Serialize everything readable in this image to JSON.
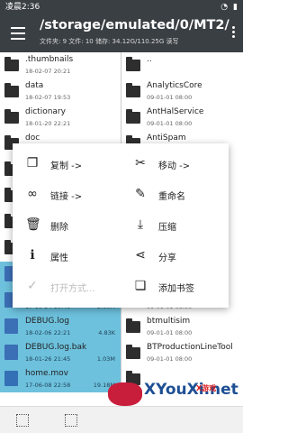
{
  "status": {
    "time": "凌晨2:36"
  },
  "appbar": {
    "path": "/storage/emulated/0/MT2/",
    "info": "文件夹: 9  文件: 10  储存: 34.12G/110.25G  读写"
  },
  "left_pane": [
    {
      "name": ".thumbnails",
      "meta": "18-02-07 20:21",
      "size": "",
      "type": "folder",
      "selected": false
    },
    {
      "name": "data",
      "meta": "18-02-07 19:53",
      "size": "",
      "type": "folder",
      "selected": false
    },
    {
      "name": "dictionary",
      "meta": "18-01-20 22:21",
      "size": "",
      "type": "folder",
      "selected": false
    },
    {
      "name": "doc",
      "meta": "",
      "size": "",
      "type": "folder",
      "selected": false
    },
    {
      "name": "",
      "meta": "",
      "size": "",
      "type": "folder",
      "selected": false
    },
    {
      "name": "",
      "meta": "",
      "size": "",
      "type": "folder",
      "selected": false
    },
    {
      "name": "",
      "meta": "",
      "size": "",
      "type": "folder",
      "selected": false
    },
    {
      "name": "",
      "meta": "",
      "size": "",
      "type": "folder",
      "selected": false
    },
    {
      "name": "",
      "meta": "",
      "size": "",
      "type": "file",
      "selected": true
    },
    {
      "name": "",
      "meta": "17-10-24 10:48",
      "size": "2.60M",
      "type": "file",
      "selected": true
    },
    {
      "name": "DEBUG.log",
      "meta": "18-02-06 22:21",
      "size": "4.83K",
      "type": "file",
      "selected": true
    },
    {
      "name": "DEBUG.log.bak",
      "meta": "18-01-26 21:45",
      "size": "1.03M",
      "type": "file",
      "selected": true
    },
    {
      "name": "home.mov",
      "meta": "17-06-08 22:58",
      "size": "19.18M",
      "type": "video",
      "selected": true
    }
  ],
  "right_pane": [
    {
      "name": "..",
      "meta": "",
      "type": "folder"
    },
    {
      "name": "AnalyticsCore",
      "meta": "09-01-01 08:00",
      "type": "app"
    },
    {
      "name": "AntHalService",
      "meta": "09-01-01 08:00",
      "type": "app"
    },
    {
      "name": "AntiSpam",
      "meta": "",
      "type": "app"
    },
    {
      "name": "",
      "meta": "",
      "type": "app"
    },
    {
      "name": "",
      "meta": "",
      "type": "app"
    },
    {
      "name": "",
      "meta": "",
      "type": "app"
    },
    {
      "name": "",
      "meta": "",
      "type": "app"
    },
    {
      "name": "",
      "meta": "",
      "type": "app"
    },
    {
      "name": "",
      "meta": "09-01-01 08:00",
      "type": "app"
    },
    {
      "name": "btmultisim",
      "meta": "09-01-01 08:00",
      "type": "app"
    },
    {
      "name": "BTProductionLineTool",
      "meta": "09-01-01 08:00",
      "type": "app"
    },
    {
      "name": "",
      "meta": "",
      "type": "app"
    }
  ],
  "menu": {
    "items": [
      {
        "label": "复制 ->",
        "icon": "copy-icon",
        "glyph": "❐"
      },
      {
        "label": "移动 ->",
        "icon": "cut-icon",
        "glyph": "✂"
      },
      {
        "label": "链接 ->",
        "icon": "link-icon",
        "glyph": "∞"
      },
      {
        "label": "重命名",
        "icon": "edit-icon",
        "glyph": "✎"
      },
      {
        "label": "删除",
        "icon": "delete-icon",
        "glyph": "🗑"
      },
      {
        "label": "压缩",
        "icon": "download-icon",
        "glyph": "⤓"
      },
      {
        "label": "属性",
        "icon": "info-icon",
        "glyph": "ℹ"
      },
      {
        "label": "分享",
        "icon": "share-icon",
        "glyph": "⋖"
      },
      {
        "label": "打开方式...",
        "icon": "check-icon",
        "glyph": "✓",
        "disabled": true
      },
      {
        "label": "添加书签",
        "icon": "bookmark-icon",
        "glyph": "❏"
      }
    ]
  },
  "watermark": {
    "text": "XYouXi.net",
    "sub": "X游戏"
  },
  "colors": {
    "appbar": "#3a3f44",
    "selected": "#6dc1dd",
    "accent": "#3b6fb6"
  }
}
